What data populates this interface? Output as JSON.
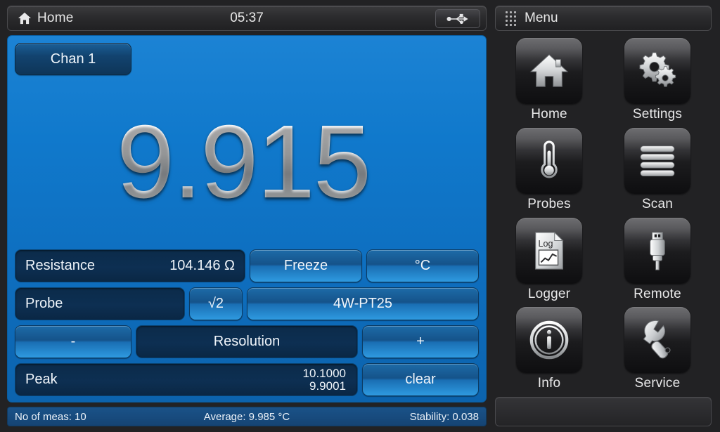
{
  "topbar": {
    "home_icon": "home-icon",
    "title": "Home",
    "clock": "05:37",
    "usb_icon": "usb-icon"
  },
  "display": {
    "channel_button": "Chan 1",
    "reading": "9.915",
    "accent_blue": "#1079cc",
    "button_blue": "#2e9ae0"
  },
  "rows": {
    "resistance": {
      "label": "Resistance",
      "value": "104.146 Ω",
      "freeze_button": "Freeze",
      "unit_button": "°C"
    },
    "probe": {
      "label": "Probe",
      "sqrt_button": "√2",
      "probe_button": "4W-PT25"
    },
    "resolution": {
      "minus_button": "-",
      "label": "Resolution",
      "plus_button": "+"
    },
    "peak": {
      "label": "Peak",
      "high_value": "10.1000",
      "low_value": "9.9001",
      "clear_button": "clear"
    }
  },
  "statusbar": {
    "no_of_meas": "No of meas: 10",
    "average": "Average: 9.985 °C",
    "stability": "Stability: 0.038"
  },
  "menu": {
    "grip_icon": "grip-dots-icon",
    "title": "Menu",
    "items": [
      {
        "label": "Home",
        "icon": "home-icon"
      },
      {
        "label": "Settings",
        "icon": "gears-icon"
      },
      {
        "label": "Probes",
        "icon": "thermometer-icon"
      },
      {
        "label": "Scan",
        "icon": "list-bars-icon"
      },
      {
        "label": "Logger",
        "icon": "log-document-chart-icon"
      },
      {
        "label": "Remote",
        "icon": "usb-plug-icon"
      },
      {
        "label": "Info",
        "icon": "info-circle-icon"
      },
      {
        "label": "Service",
        "icon": "wrench-icon"
      }
    ],
    "footer_text": ""
  }
}
